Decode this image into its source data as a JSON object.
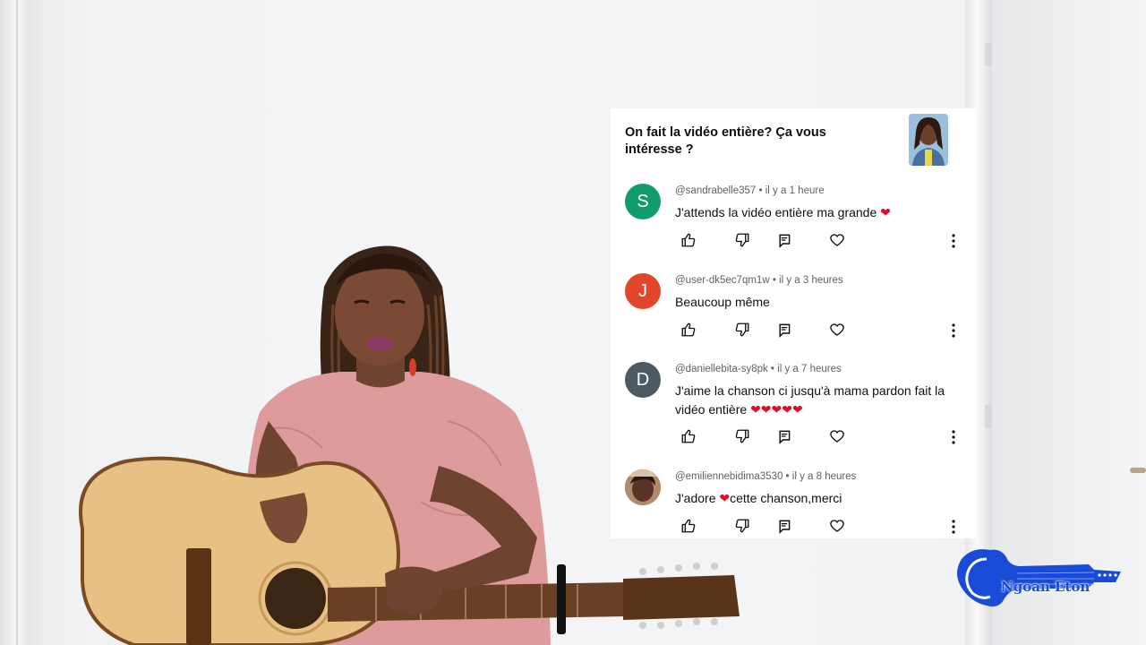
{
  "post": {
    "title": "On fait la vidéo entière? Ça vous intéresse ?"
  },
  "comments": [
    {
      "avatar_letter": "S",
      "avatar_color": "#139a6e",
      "handle": "@sandrabelle357",
      "time": " • il y a 1 heure",
      "text": "J'attends la vidéo entière ma grande",
      "hearts": "❤"
    },
    {
      "avatar_letter": "J",
      "avatar_color": "#e2462a",
      "handle": "@user-dk5ec7qm1w",
      "time": " • il y a 3 heures",
      "text": "Beaucoup même",
      "hearts": ""
    },
    {
      "avatar_letter": "D",
      "avatar_color": "#4b5a63",
      "handle": "@daniellebita-sy8pk",
      "time": " • il y a 7 heures",
      "text": "J'aime la chanson ci jusqu'à mama pardon fait la vidéo entière",
      "hearts": "❤❤❤❤❤"
    },
    {
      "avatar_letter": "",
      "avatar_color": "#6b4a3a",
      "handle": "@emiliennebidima3530",
      "time": " • il y a 8 heures",
      "text_before": "J'adore ",
      "hearts": "❤",
      "text_after": "cette chanson,merci"
    }
  ],
  "logo": {
    "text": "Ngoan Eton",
    "color": "#1a4bd8"
  },
  "icons": [
    "like-icon",
    "dislike-icon",
    "reply-icon",
    "heart-icon",
    "more-icon"
  ]
}
